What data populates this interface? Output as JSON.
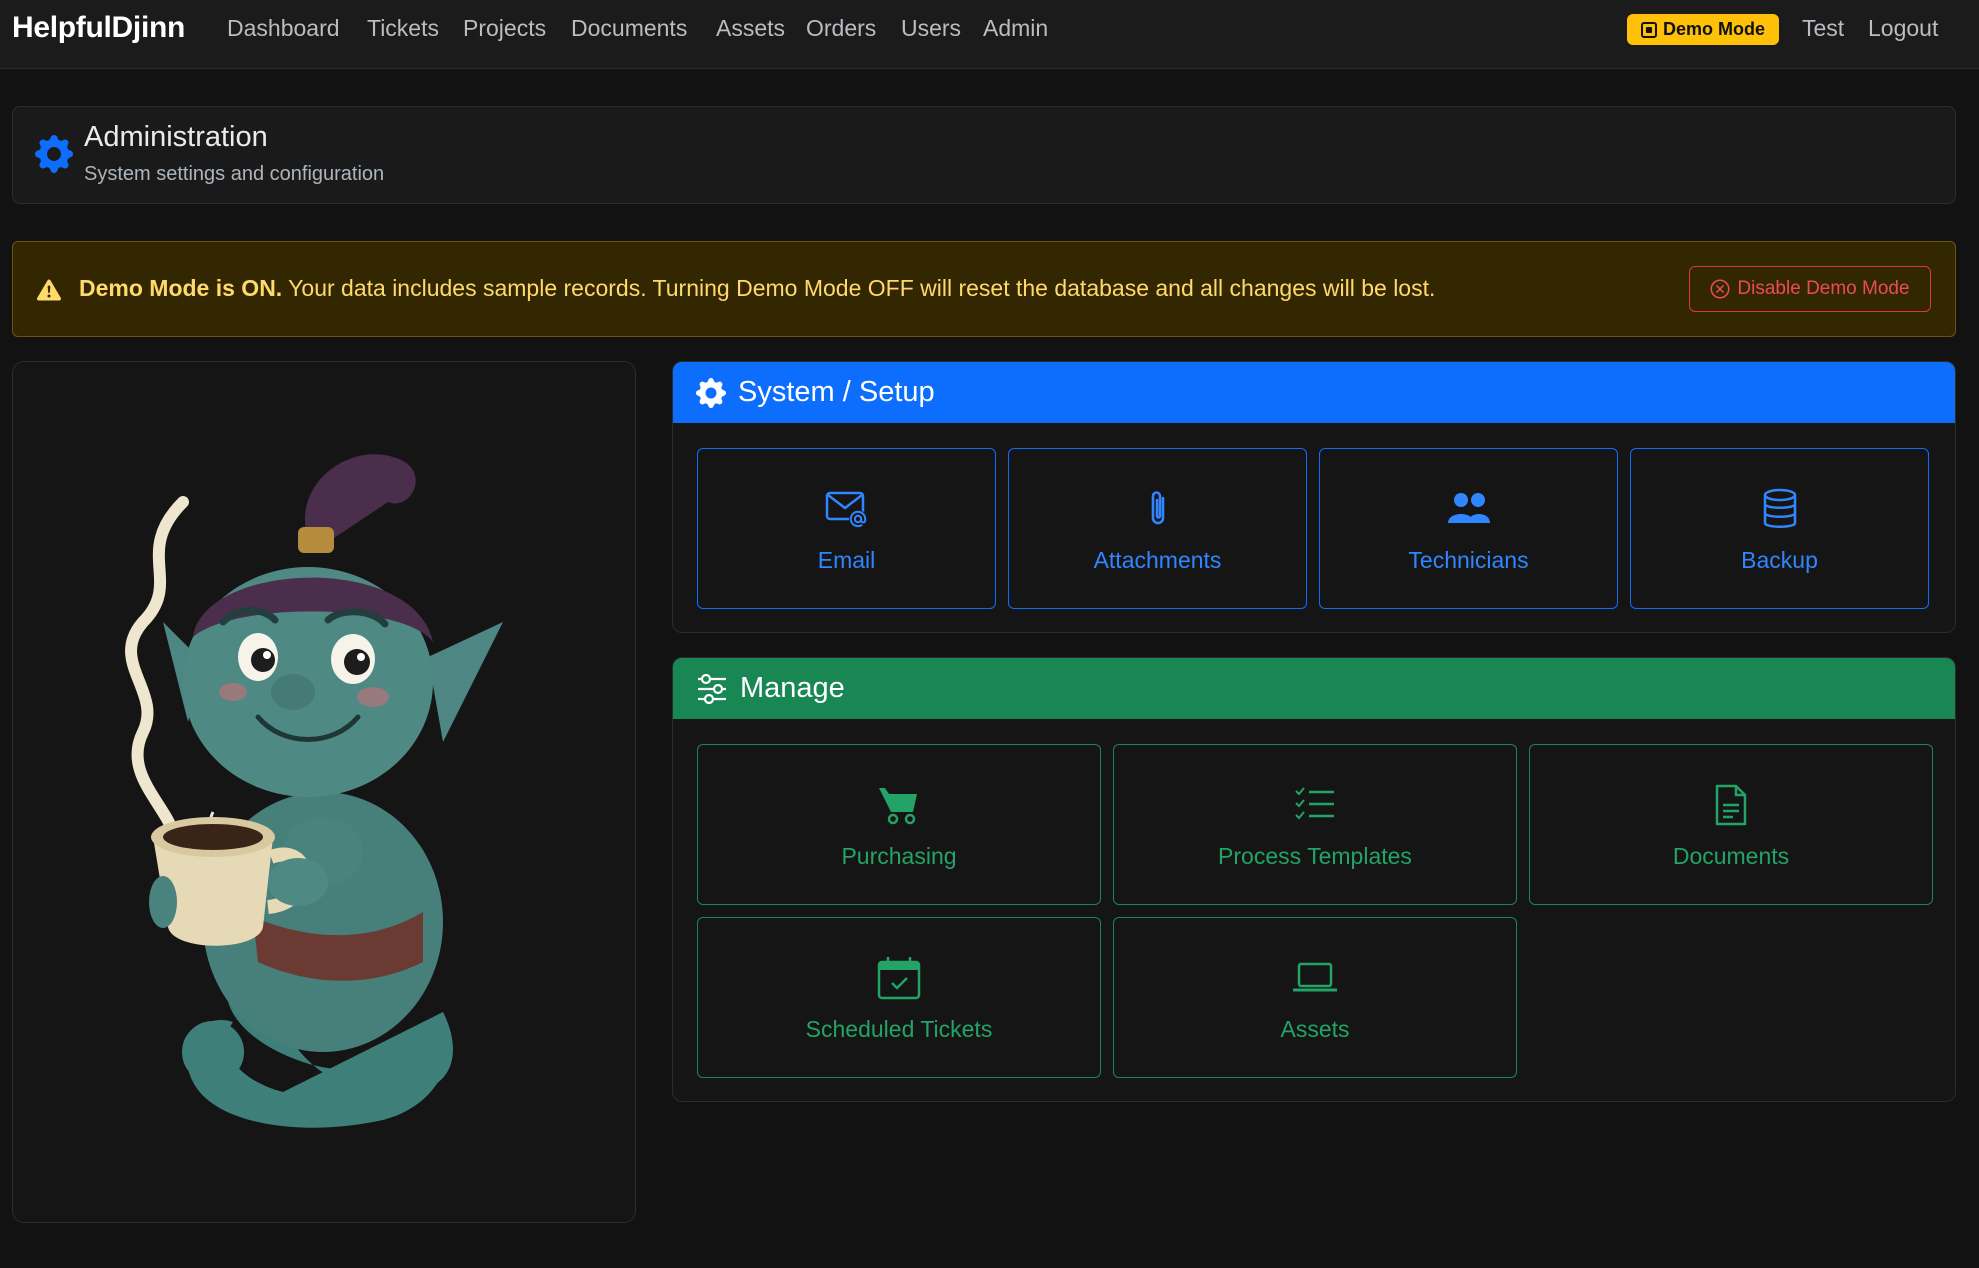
{
  "nav": {
    "brand": "HelpfulDjinn",
    "links": [
      "Dashboard",
      "Tickets",
      "Projects",
      "Documents",
      "Assets",
      "Orders",
      "Users",
      "Admin"
    ],
    "demo_badge": "Demo Mode",
    "user": "Test",
    "logout": "Logout"
  },
  "header": {
    "title": "Administration",
    "subtitle": "System settings and configuration",
    "icon": "gear-icon"
  },
  "alert": {
    "strong": "Demo Mode is ON.",
    "message": " Your data includes sample records. Turning Demo Mode OFF will reset the database and all changes will be lost.",
    "button": "Disable Demo Mode",
    "icon": "warning-triangle-icon"
  },
  "system_section": {
    "title": "System / Setup",
    "tiles": [
      {
        "label": "Email",
        "icon": "email-at-icon"
      },
      {
        "label": "Attachments",
        "icon": "paperclip-icon"
      },
      {
        "label": "Technicians",
        "icon": "people-icon"
      },
      {
        "label": "Backup",
        "icon": "database-icon"
      }
    ]
  },
  "manage_section": {
    "title": "Manage",
    "tiles": [
      {
        "label": "Purchasing",
        "icon": "cart-icon"
      },
      {
        "label": "Process Templates",
        "icon": "checklist-icon"
      },
      {
        "label": "Documents",
        "icon": "document-icon"
      },
      {
        "label": "Scheduled Tickets",
        "icon": "calendar-check-icon"
      },
      {
        "label": "Assets",
        "icon": "laptop-icon"
      }
    ]
  },
  "colors": {
    "primary": "#0d6efd",
    "success": "#198754",
    "warning": "#ffc107",
    "danger": "#dc3545",
    "background": "#121212"
  }
}
